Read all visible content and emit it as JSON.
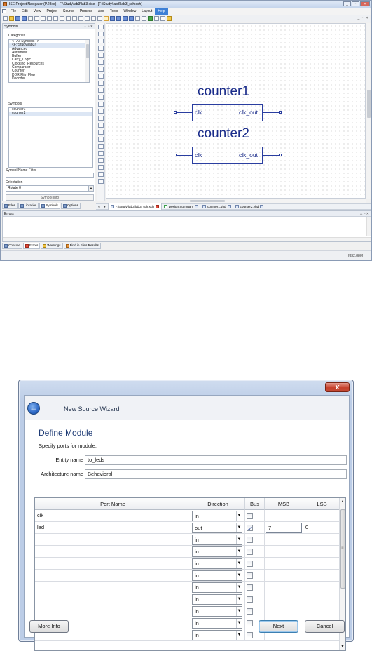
{
  "ise": {
    "title": "ISE Project Navigator (P.28xd) - F:\\Study\\lab3\\lab3.xise - [F:\\Study\\lab3\\lab3_sch.sch]",
    "menu": [
      "File",
      "Edit",
      "View",
      "Project",
      "Source",
      "Process",
      "Add",
      "Tools",
      "Window",
      "Layout",
      "Help"
    ],
    "menu_highlight": "Help",
    "mdi_controls": "_ ▫ ✕",
    "symbols_panel": {
      "title": "Symbols",
      "controls": "↔ ▫ ✕",
      "categories_label": "Categories",
      "categories": [
        "<--All Symbols-->",
        "<F:\\Study\\lab3>",
        "Advanced",
        "Arithmetic",
        "Buffer",
        "Carry_Logic",
        "Clocking_Resources",
        "Comparator",
        "Counter",
        "DDR Flip_Flop",
        "Decoder"
      ],
      "categories_selected_index": 1,
      "symbols_label": "Symbols",
      "symbols": [
        "counter1",
        "counter2"
      ],
      "name_filter_label": "Symbol Name Filter",
      "orientation_label": "Orientation",
      "orientation_value": "Rotate 0",
      "symbol_info_label": "Symbol Info"
    },
    "left_tabs": [
      "Files",
      "Libraries",
      "Symbols",
      "Options"
    ],
    "left_tabs_active": "Symbols",
    "schematic": {
      "instances": [
        {
          "title": "counter1",
          "in_pin": "clk",
          "out_pin": "clk_out"
        },
        {
          "title": "counter2",
          "in_pin": "clk",
          "out_pin": "clk_out"
        }
      ]
    },
    "doc_tabs": [
      "F:\\Study\\lab3\\lab3_sch.sch",
      "Design Summary",
      "counter1.vhd",
      "counter2.vhd"
    ],
    "doc_tab_active": "F:\\Study\\lab3\\lab3_sch.sch",
    "errors_panel_title": "Errors",
    "console_tabs": [
      "Console",
      "Errors",
      "Warnings",
      "Find in Files Results"
    ],
    "console_tab_active": "Errors",
    "status_coordinates": "[832,880]"
  },
  "wizard": {
    "title": "New Source Wizard",
    "close_label": "x",
    "page_title": "Define Module",
    "page_description": "Specify ports for module.",
    "entity_label": "Entity name",
    "entity_value": "to_leds",
    "architecture_label": "Architecture name",
    "architecture_value": "Behavioral",
    "columns": [
      "Port Name",
      "Direction",
      "Bus",
      "MSB",
      "LSB"
    ],
    "ports": [
      {
        "name": "clk",
        "direction": "in",
        "bus": false,
        "msb": "",
        "lsb": ""
      },
      {
        "name": "led",
        "direction": "out",
        "bus": true,
        "msb": "7",
        "lsb": "0"
      },
      {
        "name": "",
        "direction": "in",
        "bus": false,
        "msb": "",
        "lsb": ""
      },
      {
        "name": "",
        "direction": "in",
        "bus": false,
        "msb": "",
        "lsb": ""
      },
      {
        "name": "",
        "direction": "in",
        "bus": false,
        "msb": "",
        "lsb": ""
      },
      {
        "name": "",
        "direction": "in",
        "bus": false,
        "msb": "",
        "lsb": ""
      },
      {
        "name": "",
        "direction": "in",
        "bus": false,
        "msb": "",
        "lsb": ""
      },
      {
        "name": "",
        "direction": "in",
        "bus": false,
        "msb": "",
        "lsb": ""
      },
      {
        "name": "",
        "direction": "in",
        "bus": false,
        "msb": "",
        "lsb": ""
      },
      {
        "name": "",
        "direction": "in",
        "bus": false,
        "msb": "",
        "lsb": ""
      },
      {
        "name": "",
        "direction": "in",
        "bus": false,
        "msb": "",
        "lsb": ""
      }
    ],
    "buttons": {
      "more_info": "More Info",
      "next": "Next",
      "cancel": "Cancel"
    },
    "colors": {
      "close_button": "#c6402c",
      "title_text": "#1e3b75",
      "back_button": "#2f6ac7"
    }
  },
  "colors": {
    "schematic_ink": "#1a2c8a",
    "menu_highlight": "#3e80d6"
  }
}
